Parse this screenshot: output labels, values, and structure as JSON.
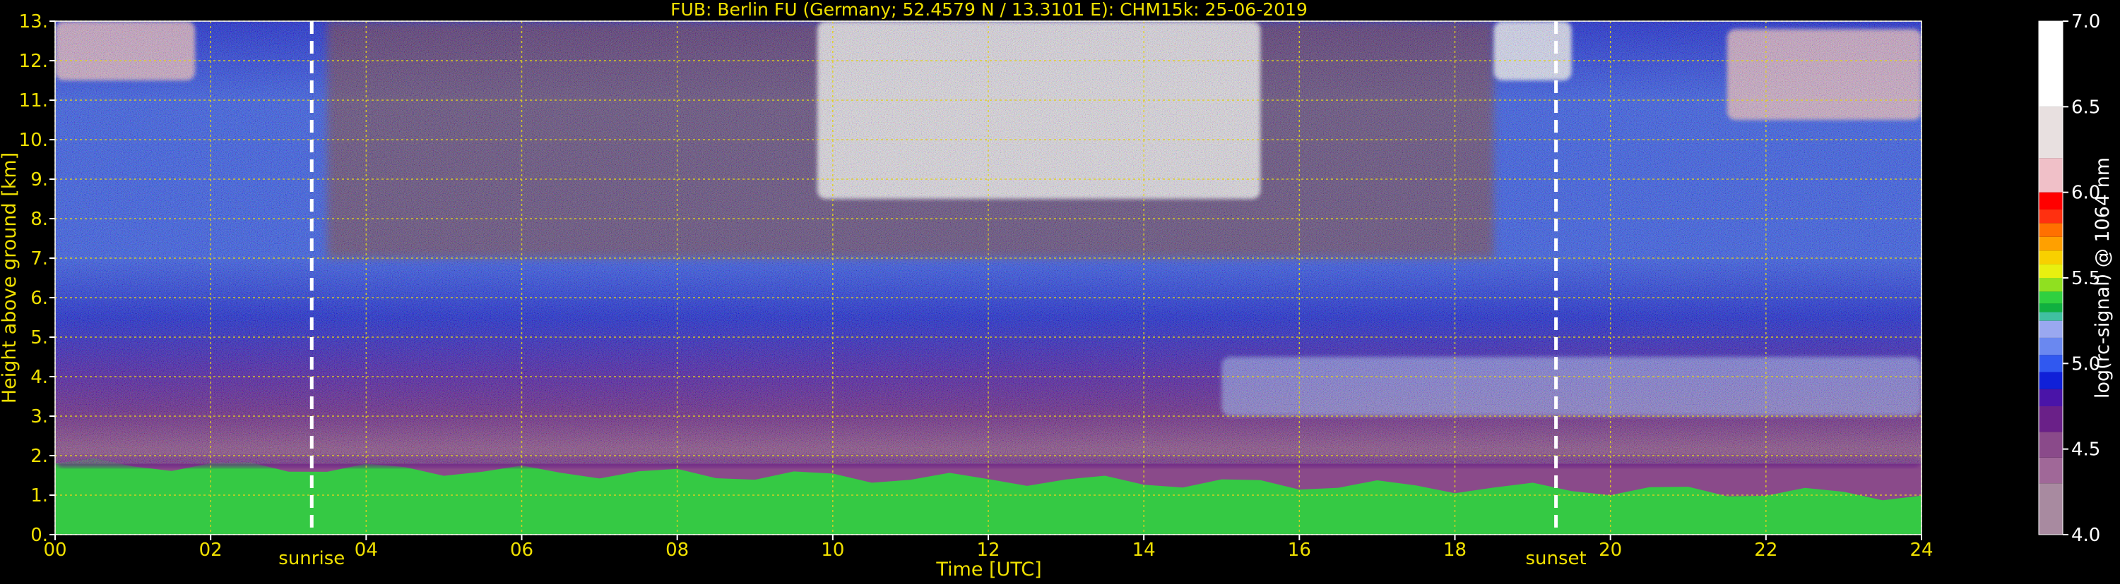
{
  "chart_data": {
    "type": "heatmap",
    "title": "FUB: Berlin FU (Germany; 52.4579 N / 13.3101 E):    CHM15k: 25-06-2019",
    "xlabel": "Time [UTC]",
    "ylabel": "Height above ground [km]",
    "xlim": [
      0,
      24
    ],
    "ylim": [
      0,
      13
    ],
    "x_ticks": [
      0,
      2,
      4,
      6,
      8,
      10,
      12,
      14,
      16,
      18,
      20,
      22,
      24
    ],
    "x_tick_labels": [
      "00",
      "02",
      "04",
      "06",
      "08",
      "10",
      "12",
      "14",
      "16",
      "18",
      "20",
      "22",
      "24"
    ],
    "y_ticks": [
      0,
      1,
      2,
      3,
      4,
      5,
      6,
      7,
      8,
      9,
      10,
      11,
      12,
      13
    ],
    "y_tick_labels": [
      "0.",
      "1.",
      "2.",
      "3.",
      "4.",
      "5.",
      "6.",
      "7.",
      "8.",
      "9.",
      "10.",
      "11.",
      "12.",
      "13."
    ],
    "grid": true,
    "colorbar": {
      "label": "log(rc-signal) @ 1064 nm",
      "range": [
        4.0,
        7.0
      ],
      "ticks": [
        4.0,
        4.5,
        5.0,
        5.5,
        6.0,
        6.5,
        7.0
      ],
      "tick_labels": [
        "4.0",
        "4.5",
        "5.0",
        "5.5",
        "6.0",
        "6.5",
        "7.0"
      ],
      "levels": [
        {
          "from": 4.0,
          "to": 4.3,
          "color": "#a88aa0"
        },
        {
          "from": 4.3,
          "to": 4.45,
          "color": "#a06898"
        },
        {
          "from": 4.45,
          "to": 4.6,
          "color": "#8a4a8a"
        },
        {
          "from": 4.6,
          "to": 4.75,
          "color": "#6a2088"
        },
        {
          "from": 4.75,
          "to": 4.85,
          "color": "#4a14a8"
        },
        {
          "from": 4.85,
          "to": 4.95,
          "color": "#1020d8"
        },
        {
          "from": 4.95,
          "to": 5.05,
          "color": "#3058f0"
        },
        {
          "from": 5.05,
          "to": 5.15,
          "color": "#6a88f0"
        },
        {
          "from": 5.15,
          "to": 5.25,
          "color": "#9aa8f0"
        },
        {
          "from": 5.25,
          "to": 5.3,
          "color": "#40c0a0"
        },
        {
          "from": 5.3,
          "to": 5.35,
          "color": "#10b040"
        },
        {
          "from": 5.35,
          "to": 5.42,
          "color": "#30d040"
        },
        {
          "from": 5.42,
          "to": 5.5,
          "color": "#90e020"
        },
        {
          "from": 5.5,
          "to": 5.58,
          "color": "#e8f010"
        },
        {
          "from": 5.58,
          "to": 5.66,
          "color": "#f8d000"
        },
        {
          "from": 5.66,
          "to": 5.74,
          "color": "#ffa000"
        },
        {
          "from": 5.74,
          "to": 5.82,
          "color": "#ff7000"
        },
        {
          "from": 5.82,
          "to": 5.9,
          "color": "#ff3010"
        },
        {
          "from": 5.9,
          "to": 6.0,
          "color": "#ff0000"
        },
        {
          "from": 6.0,
          "to": 6.2,
          "color": "#f0c0c8"
        },
        {
          "from": 6.2,
          "to": 6.5,
          "color": "#e8e0e0"
        },
        {
          "from": 6.5,
          "to": 7.0,
          "color": "#ffffff"
        }
      ]
    },
    "annotations": [
      {
        "label": "sunrise",
        "x": 3.3
      },
      {
        "label": "sunset",
        "x": 19.3
      }
    ],
    "features": [
      {
        "kind": "mixed_layer",
        "time": [
          0,
          24
        ],
        "height_top": [
          1.8,
          1.0
        ],
        "value": 5.4
      },
      {
        "kind": "residual_layer",
        "time": [
          0,
          24
        ],
        "height": [
          1.7,
          2.0
        ],
        "value": 4.7
      },
      {
        "kind": "aerosol_layer",
        "time": [
          15,
          24
        ],
        "height": [
          3.0,
          4.5
        ],
        "value": 5.2
      },
      {
        "kind": "cirrus",
        "time": [
          0,
          1.8
        ],
        "height": [
          11.5,
          13
        ],
        "value": 6.2
      },
      {
        "kind": "cirrus",
        "time": [
          9.8,
          15.5
        ],
        "height": [
          8.5,
          13
        ],
        "value": 6.8
      },
      {
        "kind": "cirrus",
        "time": [
          18.5,
          19.5
        ],
        "height": [
          11.5,
          13
        ],
        "value": 6.8
      },
      {
        "kind": "cirrus",
        "time": [
          21.5,
          24
        ],
        "height": [
          10.5,
          12.8
        ],
        "value": 6.2
      }
    ],
    "colors": {
      "text": "#f0e000",
      "white_text": "#ffffff",
      "grid": "#e0d020",
      "background": "#000000"
    }
  }
}
